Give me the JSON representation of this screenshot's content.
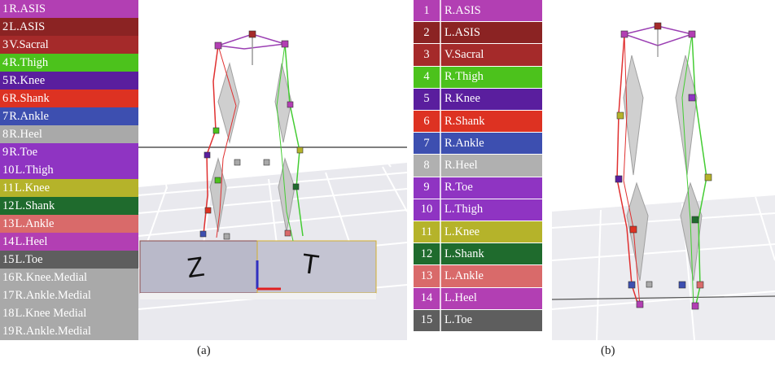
{
  "panel_a": {
    "caption": "(a)",
    "markers": [
      {
        "num": "1",
        "label": "R.ASIS",
        "color": "#b23fb3"
      },
      {
        "num": "2",
        "label": "L.ASIS",
        "color": "#8b2323"
      },
      {
        "num": "3",
        "label": "V.Sacral",
        "color": "#a52a2a"
      },
      {
        "num": "4",
        "label": "R.Thigh",
        "color": "#4cc21c"
      },
      {
        "num": "5",
        "label": "R.Knee",
        "color": "#5a1e9e"
      },
      {
        "num": "6",
        "label": "R.Shank",
        "color": "#dd3222"
      },
      {
        "num": "7",
        "label": "R.Ankle",
        "color": "#3d4fb0"
      },
      {
        "num": "8",
        "label": "R.Heel",
        "color": "#a9a9a9"
      },
      {
        "num": "9",
        "label": "R.Toe",
        "color": "#8f34c2"
      },
      {
        "num": "10",
        "label": "L.Thigh",
        "color": "#8f34c2"
      },
      {
        "num": "11",
        "label": "L.Knee",
        "color": "#b5b32a"
      },
      {
        "num": "12",
        "label": "L.Shank",
        "color": "#1f6b2d"
      },
      {
        "num": "13",
        "label": "L.Ankle",
        "color": "#d96a6a"
      },
      {
        "num": "14",
        "label": "L.Heel",
        "color": "#b23fb3"
      },
      {
        "num": "15",
        "label": "L.Toe",
        "color": "#5e5e5e"
      },
      {
        "num": "16",
        "label": "R.Knee.Medial",
        "color": "#a9a9a9"
      },
      {
        "num": "17",
        "label": "R.Ankle.Medial",
        "color": "#a9a9a9"
      },
      {
        "num": "18",
        "label": "L.Knee Medial",
        "color": "#a9a9a9"
      },
      {
        "num": "19",
        "label": "R.Ankle.Medial",
        "color": "#a9a9a9"
      }
    ]
  },
  "panel_b": {
    "caption": "(b)",
    "markers": [
      {
        "num": "1",
        "label": "R.ASIS",
        "color": "#b23fb3"
      },
      {
        "num": "2",
        "label": "L.ASIS",
        "color": "#8b2323"
      },
      {
        "num": "3",
        "label": "V.Sacral",
        "color": "#a52a2a"
      },
      {
        "num": "4",
        "label": "R.Thigh",
        "color": "#4cc21c"
      },
      {
        "num": "5",
        "label": "R.Knee",
        "color": "#5a1e9e"
      },
      {
        "num": "6",
        "label": "R.Shank",
        "color": "#dd3222"
      },
      {
        "num": "7",
        "label": "R.Ankle",
        "color": "#3d4fb0"
      },
      {
        "num": "8",
        "label": "R.Heel",
        "color": "#b0b0b0"
      },
      {
        "num": "9",
        "label": "R.Toe",
        "color": "#8f34c2"
      },
      {
        "num": "10",
        "label": "L.Thigh",
        "color": "#8f34c2"
      },
      {
        "num": "11",
        "label": "L.Knee",
        "color": "#b5b32a"
      },
      {
        "num": "12",
        "label": "L.Shank",
        "color": "#1f6b2d"
      },
      {
        "num": "13",
        "label": "L.Ankle",
        "color": "#d96a6a"
      },
      {
        "num": "14",
        "label": "L.Heel",
        "color": "#b23fb3"
      },
      {
        "num": "15",
        "label": "L.Toe",
        "color": "#5e5e5e"
      }
    ]
  },
  "colors": {
    "grid_floor": "#e6e6ea",
    "grid_line": "#ffffff",
    "horizon": "#555555",
    "segment": "#c8c8c8",
    "right_link": "#e03030",
    "left_link": "#44cc33",
    "pelvis_link": "#9b3fb3",
    "force_plate": "#b9b9c9"
  },
  "force_plate_labels": [
    "Z",
    "T"
  ]
}
